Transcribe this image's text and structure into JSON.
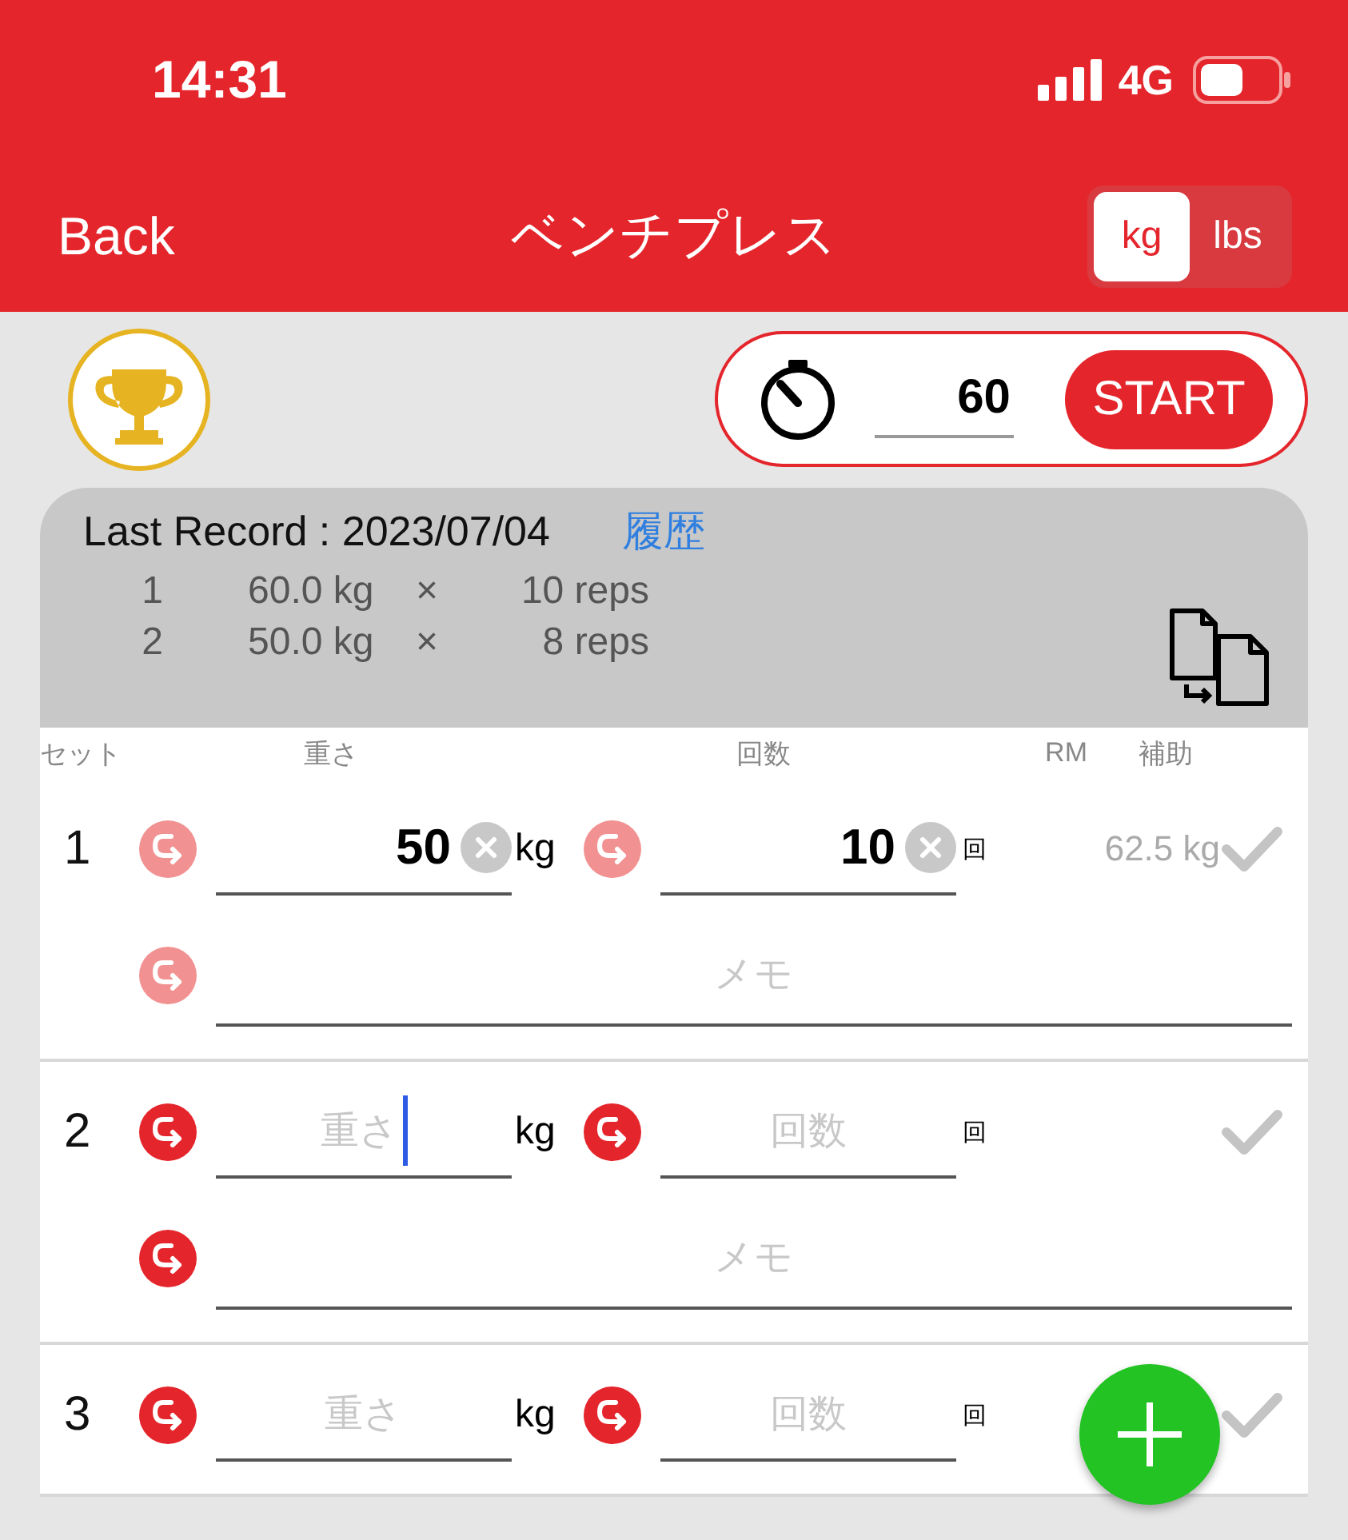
{
  "status_bar": {
    "time": "14:31",
    "network": "4G"
  },
  "nav": {
    "back": "Back",
    "title": "ベンチプレス",
    "units": [
      {
        "label": "kg",
        "selected": true
      },
      {
        "label": "lbs",
        "selected": false
      }
    ]
  },
  "timer": {
    "seconds": "60",
    "button": "START"
  },
  "last_record": {
    "title": "Last Record : 2023/07/04",
    "history_link": "履歴",
    "sets": [
      {
        "index": "1",
        "weight": "60.0 kg",
        "times": "×",
        "reps": "10 reps"
      },
      {
        "index": "2",
        "weight": "50.0 kg",
        "times": "×",
        "reps": "8 reps"
      }
    ]
  },
  "columns": [
    "セット",
    "重さ",
    "回数",
    "RM",
    "補助"
  ],
  "sets": [
    {
      "number": "1",
      "copy_faded": true,
      "weight": {
        "value": "50",
        "focused": false
      },
      "weight_unit": "kg",
      "reps": {
        "value": "10",
        "focused": false
      },
      "reps_unit": "回",
      "rm": "62.5 kg",
      "memo": {
        "placeholder": "メモ"
      }
    },
    {
      "number": "2",
      "copy_faded": false,
      "weight": {
        "placeholder": "重さ",
        "focused": true
      },
      "weight_unit": "kg",
      "reps": {
        "placeholder": "回数",
        "focused": false
      },
      "reps_unit": "回",
      "memo": {
        "placeholder": "メモ"
      }
    },
    {
      "number": "3",
      "copy_faded": false,
      "weight": {
        "placeholder": "重さ",
        "focused": false
      },
      "weight_unit": "kg",
      "reps": {
        "placeholder": "回数",
        "focused": false
      },
      "reps_unit": "回"
    }
  ]
}
